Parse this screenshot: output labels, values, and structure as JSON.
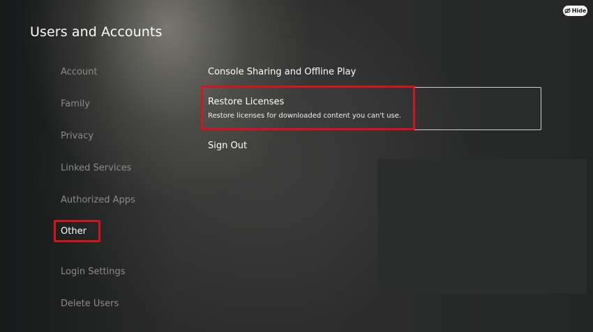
{
  "hide_button": {
    "label": "Hide",
    "icon": "eye-slash-icon"
  },
  "page_title": "Users and Accounts",
  "sidebar": {
    "items": [
      {
        "label": "Account"
      },
      {
        "label": "Family"
      },
      {
        "label": "Privacy"
      },
      {
        "label": "Linked Services"
      },
      {
        "label": "Authorized Apps"
      },
      {
        "label": "Other",
        "selected": true
      },
      {
        "label": "Login Settings"
      },
      {
        "label": "Delete Users"
      }
    ]
  },
  "options": {
    "console_sharing": {
      "label": "Console Sharing and Offline Play"
    },
    "restore_licenses": {
      "label": "Restore Licenses",
      "description": "Restore licenses for downloaded content you can't use."
    },
    "sign_out": {
      "label": "Sign Out"
    }
  },
  "colors": {
    "highlight": "#d4141c",
    "text_primary": "#ffffff",
    "text_secondary": "#8c8c8a"
  }
}
